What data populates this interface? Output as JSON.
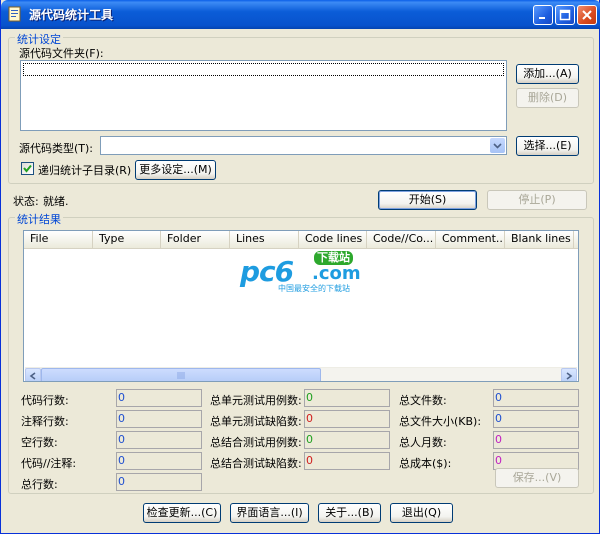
{
  "window": {
    "title": "源代码统计工具"
  },
  "settings": {
    "group_title": "统计设定",
    "folder_label": "源代码文件夹(F):",
    "add_button": "添加...(A)",
    "delete_button": "删除(D)",
    "type_label": "源代码类型(T):",
    "type_value": "",
    "select_button": "选择...(E)",
    "recursive_label": "递归统计子目录(R)",
    "recursive_checked": true,
    "more_button": "更多设定...(M)"
  },
  "status": {
    "label": "状态:",
    "value": "就绪.",
    "start_button": "开始(S)",
    "stop_button": "停止(P)"
  },
  "results": {
    "group_title": "统计结果",
    "columns": [
      "File",
      "Type",
      "Folder",
      "Lines",
      "Code lines",
      "Code//Co...",
      "Comment...",
      "Blank lines"
    ],
    "rows": []
  },
  "watermark": {
    "brand": "pc6",
    "badge": "下载站",
    "domain": ".com",
    "slogan": "中国最安全的下载站"
  },
  "stats": {
    "col1": [
      {
        "label": "代码行数:",
        "value": "0"
      },
      {
        "label": "注释行数:",
        "value": "0"
      },
      {
        "label": "空行数:",
        "value": "0"
      },
      {
        "label": "代码//注释:",
        "value": "0"
      },
      {
        "label": "总行数:",
        "value": "0"
      }
    ],
    "col2": [
      {
        "label": "总单元测试用例数:",
        "value": "0"
      },
      {
        "label": "总单元测试缺陷数:",
        "value": "0"
      },
      {
        "label": "总结合测试用例数:",
        "value": "0"
      },
      {
        "label": "总结合测试缺陷数:",
        "value": "0"
      }
    ],
    "col3": [
      {
        "label": "总文件数:",
        "value": "0"
      },
      {
        "label": "总文件大小(KB):",
        "value": "0"
      },
      {
        "label": "总人月数:",
        "value": "0"
      },
      {
        "label": "总成本($):",
        "value": "0"
      }
    ],
    "save_button": "保存...(V)"
  },
  "footer": {
    "check_update": "检查更新...(C)",
    "language": "界面语言...(I)",
    "about": "关于...(B)",
    "exit": "退出(Q)"
  },
  "colors": {
    "title_bar": "#0B5DD8",
    "group_title": "#0046D5",
    "blue": "#2050D0",
    "red": "#D02020",
    "green": "#20A020",
    "pink": "#C020C0"
  }
}
